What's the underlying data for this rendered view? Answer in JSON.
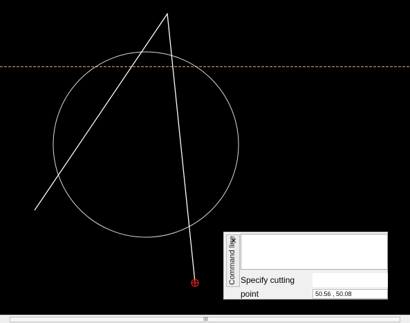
{
  "drawing": {
    "colors": {
      "background": "#000000",
      "construction_line": "#e8a860",
      "circle": "#e0e0e0",
      "polyline": "#ffffff",
      "cursor": "#e02020"
    }
  },
  "command_panel": {
    "title": "Command line",
    "close_label": "✕",
    "prompt": "Specify cutting point",
    "input_value": "",
    "coordinates": "50.56 , 50.08"
  },
  "scrollbar": {
    "grip": "III"
  }
}
